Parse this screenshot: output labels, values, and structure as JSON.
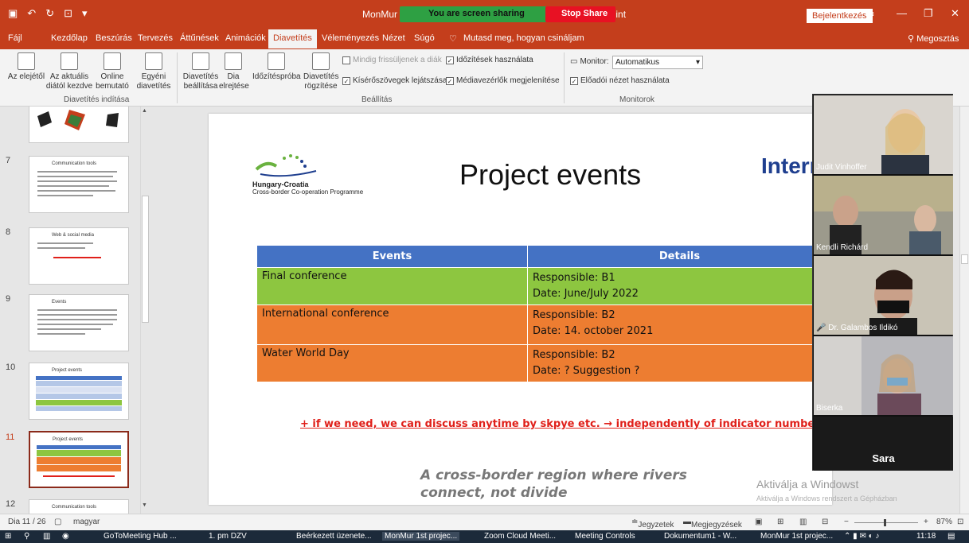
{
  "window": {
    "title_left": "MonMur 1st pr",
    "title_right": "verPoint",
    "share_banner": "You are screen sharing",
    "stop_share": "Stop Share",
    "login": "Bejelentkezés",
    "share_menu": "Megosztás"
  },
  "menu": {
    "tabs": [
      "Fájl",
      "Kezdőlap",
      "Beszúrás",
      "Tervezés",
      "Áttűnések",
      "Animációk",
      "Diavetítés",
      "Véleményezés",
      "Nézet",
      "Súgó"
    ],
    "tellme": "Mutasd meg, hogyan csináljam",
    "active": "Diavetítés"
  },
  "ribbon": {
    "from_start": "Az elejétől",
    "from_current": "Az aktuális diától kezdve",
    "online": "Online bemutató",
    "custom": "Egyéni diavetítés",
    "group_start": "Diavetítés indítása",
    "setup": "Diavetítés beállítása",
    "hide": "Dia elrejtése",
    "rehearse": "Időzítéspróba",
    "record": "Diavetítés rögzítése",
    "always_refresh": "Mindig frissüljenek a diák",
    "use_timings": "Időzítések használata",
    "play_narr": "Kísérőszövegek lejátszása",
    "show_media": "Médiavezérlők megjelenítése",
    "group_setup": "Beállítás",
    "monitor_label": "Monitor:",
    "monitor_value": "Automatikus",
    "presenter_view": "Előadói nézet használata",
    "group_monitors": "Monitorok"
  },
  "thumbnails": [
    {
      "num": "7",
      "title": "Communication tools"
    },
    {
      "num": "8",
      "title": "Web & social media"
    },
    {
      "num": "9",
      "title": "Events"
    },
    {
      "num": "10",
      "title": "Project events"
    },
    {
      "num": "11",
      "title": "Project events"
    },
    {
      "num": "12",
      "title": "Communication tools"
    }
  ],
  "slide": {
    "title": "Project events",
    "logo_line1": "Hungary-Croatia",
    "logo_line2": "Cross-border Co-operation Programme",
    "interreg": "Interr",
    "table_headers": [
      "Events",
      "Details"
    ],
    "rows": [
      {
        "event": "Final conference",
        "resp_label": "Responsible:",
        "resp": " B1",
        "date": "Date: June/July 2022"
      },
      {
        "event": "International conference",
        "resp_label": "Responsible:",
        "resp": " B2",
        "date": "Date: 14. october 2021"
      },
      {
        "event": "Water World Day",
        "resp_label": "Responsible:",
        "resp": " B2",
        "date": "Date: ? Suggestion ?"
      }
    ],
    "note": "+ if we need, we can discuss anytime by skpye etc. → independently of indicator numbers",
    "tagline1": "A cross-border region where rivers",
    "tagline2": "connect, not divide"
  },
  "activate": {
    "line1": "Aktiválja a Windowst",
    "line2": "Aktiválja a Windows rendszert a Gépházban"
  },
  "participants": [
    "Judit Vinhoffer",
    "Kendli Richárd",
    "Dr. Galambos Ildikó",
    "Biserka",
    "Sara"
  ],
  "statusbar": {
    "slide": "Dia 11 / 26",
    "lang": "magyar",
    "notes": "Jegyzetek",
    "comments": "Megjegyzések",
    "zoom": "87%"
  },
  "taskbar": {
    "items": [
      "GoToMeeting Hub ...",
      "1. pm DZV",
      "Beérkezett üzenete...",
      "MonMur 1st projec...",
      "Zoom Cloud Meeti...",
      "Meeting Controls",
      "Dokumentum1 - W...",
      "MonMur 1st projec..."
    ],
    "time": "11:18"
  },
  "colors": {
    "accent": "#c43e1c",
    "header": "#4472c4",
    "green_row": "#8dc640",
    "orange_row": "#ed7d31",
    "note": "#e0201a"
  }
}
